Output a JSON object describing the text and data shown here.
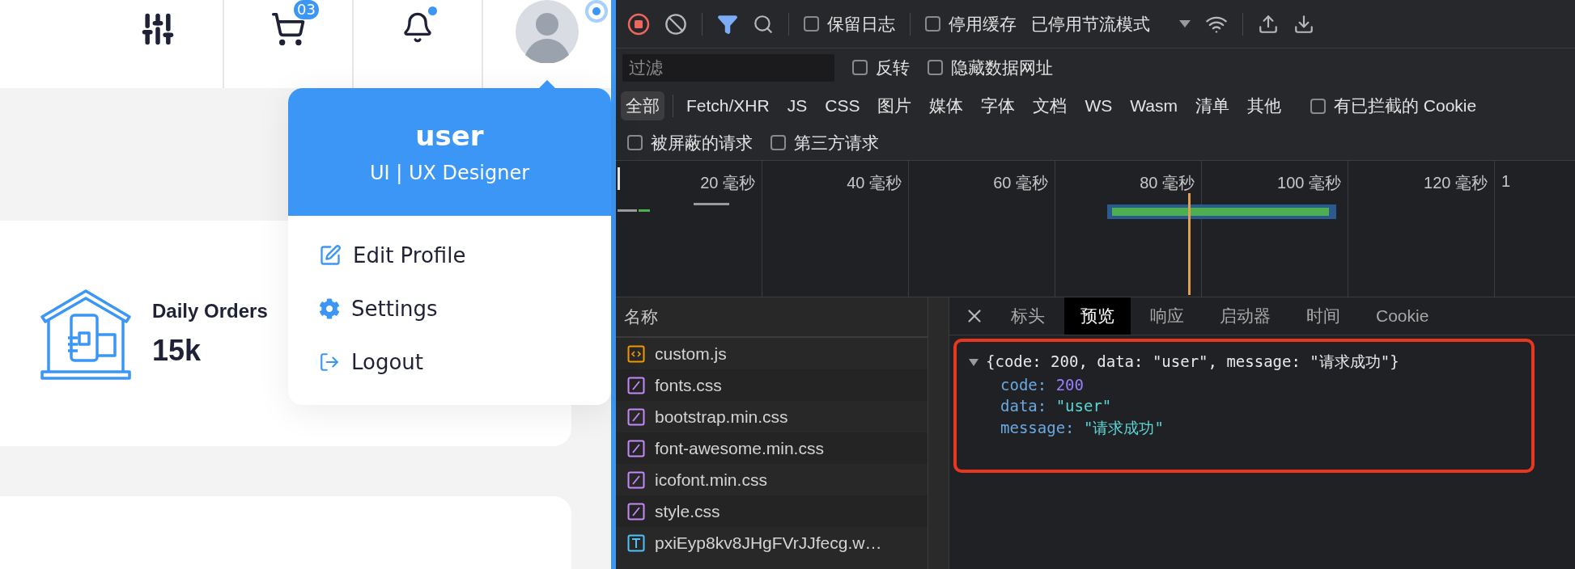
{
  "header": {
    "cart_badge": "03",
    "bell_dot": true,
    "avatar_status": true
  },
  "profile_menu": {
    "name": "user",
    "role": "UI | UX Designer",
    "items": [
      {
        "label": "Edit Profile",
        "kind": "edit"
      },
      {
        "label": "Settings",
        "kind": "settings"
      },
      {
        "label": "Logout",
        "kind": "logout"
      }
    ]
  },
  "stat_card": {
    "title": "Daily Orders",
    "value": "15k"
  },
  "devtools": {
    "toolbar": {
      "recording": true,
      "checkboxes": [
        {
          "label": "保留日志",
          "checked": false
        },
        {
          "label": "停用缓存",
          "checked": false
        }
      ],
      "throttle": "已停用节流模式"
    },
    "filter": {
      "placeholder": "过滤",
      "options": [
        {
          "label": "反转",
          "checked": false
        },
        {
          "label": "隐藏数据网址",
          "checked": false
        }
      ]
    },
    "type_filters": [
      {
        "label": "全部",
        "selected": true
      },
      {
        "label": "Fetch/XHR",
        "selected": false
      },
      {
        "label": "JS",
        "selected": false
      },
      {
        "label": "CSS",
        "selected": false
      },
      {
        "label": "图片",
        "selected": false
      },
      {
        "label": "媒体",
        "selected": false
      },
      {
        "label": "字体",
        "selected": false
      },
      {
        "label": "文档",
        "selected": false
      },
      {
        "label": "WS",
        "selected": false
      },
      {
        "label": "Wasm",
        "selected": false
      },
      {
        "label": "清单",
        "selected": false
      },
      {
        "label": "其他",
        "selected": false
      }
    ],
    "blocked_cookies": {
      "label": "有已拦截的 Cookie",
      "checked": false
    },
    "extra_filters": [
      {
        "label": "被屏蔽的请求",
        "checked": false
      },
      {
        "label": "第三方请求",
        "checked": false
      }
    ],
    "timeline": {
      "ticks": [
        "20 毫秒",
        "40 毫秒",
        "60 毫秒",
        "80 毫秒",
        "100 毫秒",
        "120 毫秒",
        "1"
      ]
    },
    "requests": {
      "column": "名称",
      "rows": [
        {
          "name": "custom.js",
          "kind": "script"
        },
        {
          "name": "fonts.css",
          "kind": "stylesheet"
        },
        {
          "name": "bootstrap.min.css",
          "kind": "stylesheet"
        },
        {
          "name": "font-awesome.min.css",
          "kind": "stylesheet"
        },
        {
          "name": "icofont.min.css",
          "kind": "stylesheet"
        },
        {
          "name": "style.css",
          "kind": "stylesheet"
        },
        {
          "name": "pxiEyp8kv8JHgFVrJJfecg.w…",
          "kind": "font"
        }
      ]
    },
    "detail_tabs": [
      {
        "label": "标头",
        "selected": false
      },
      {
        "label": "预览",
        "selected": true
      },
      {
        "label": "响应",
        "selected": false
      },
      {
        "label": "启动器",
        "selected": false
      },
      {
        "label": "时间",
        "selected": false
      },
      {
        "label": "Cookie",
        "selected": false
      }
    ],
    "preview": {
      "expanded": true,
      "summary": "{code: 200, data: \"user\", message: \"请求成功\"}",
      "fields": [
        {
          "key": "code:",
          "value": "200",
          "kind": "number"
        },
        {
          "key": "data:",
          "value": "\"user\"",
          "kind": "string"
        },
        {
          "key": "message:",
          "value": "\"请求成功\"",
          "kind": "string"
        }
      ]
    }
  }
}
